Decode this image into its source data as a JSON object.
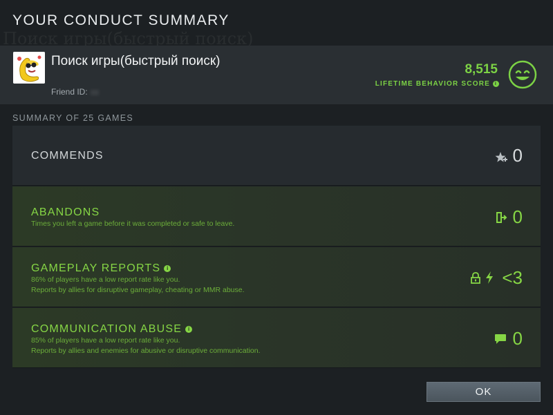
{
  "window": {
    "title": "YOUR CONDUCT SUMMARY"
  },
  "background_text": "Поиск игры(быстрый поиск)",
  "profile": {
    "name": "Поиск игры(быстрый поиск)",
    "friend_id_label": "Friend ID:",
    "avatar_icon": "banana-character-icon",
    "behavior_score": "8,515",
    "behavior_score_label": "LIFETIME BEHAVIOR SCORE",
    "score_icon": "smiley-face-icon"
  },
  "summary": {
    "label": "SUMMARY OF 25 GAMES",
    "cards": {
      "commends": {
        "title": "COMMENDS",
        "value": "0",
        "icon": "star-plus-icon"
      },
      "abandons": {
        "title": "ABANDONS",
        "description": "Times you left a game before it was completed or safe to leave.",
        "value": "0",
        "icon": "door-exit-icon"
      },
      "reports": {
        "title": "GAMEPLAY REPORTS",
        "description_1": "86% of players have a low report rate like you.",
        "description_2": "Reports by allies for disruptive gameplay, cheating or MMR abuse.",
        "value": "<3",
        "icons": [
          "lock-icon",
          "lightning-icon"
        ]
      },
      "communication": {
        "title": "COMMUNICATION ABUSE",
        "description_1": "85% of players have a low report rate like you.",
        "description_2": "Reports by allies and enemies for abusive or disruptive communication.",
        "value": "0",
        "icon": "chat-bubble-icon"
      }
    }
  },
  "buttons": {
    "ok": "OK"
  },
  "colors": {
    "accent_green": "#86d645",
    "score_green": "#7cd245",
    "background": "#1c2023"
  }
}
